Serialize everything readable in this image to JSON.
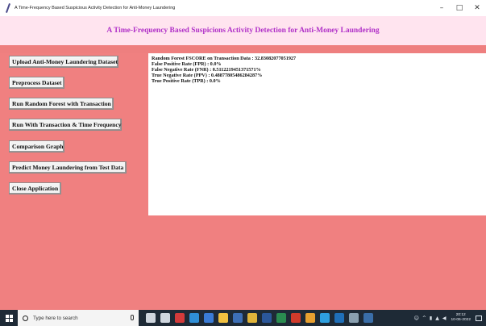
{
  "window": {
    "title": "A Time-Frequency Based Suspicious Activity Detection for Anti-Money Laundering",
    "controls": {
      "minimize": "–",
      "maximize": "□",
      "close": "✕"
    }
  },
  "heading": "A Time-Frequency Based Suspicions Activity Detection for Anti-Money Laundering",
  "buttons": [
    {
      "label": "Upload Anti-Money Laundering Dataset"
    },
    {
      "label": "Preprocess Dataset"
    },
    {
      "label": "Run Random Forest with Transaction"
    },
    {
      "label": "Run With Transaction & Time Frequency"
    },
    {
      "label": "Comparison Graph"
    },
    {
      "label": "Predict Money Laundering from Test Data"
    },
    {
      "label": "Close Application"
    }
  ],
  "output": {
    "lines": [
      "Random Forest FSCORE on Transaction Data : 32.83082077051927",
      "False Positive Rate (FPR) : 0.0%",
      "False Negative Rate (FNR) : 0.5112219451371571%",
      "True Negative Rate (PPV) : 0.48877805486284287%",
      "True Positive Rate (TPR) : 0.0%"
    ]
  },
  "taskbar": {
    "search_placeholder": "Type here to search",
    "clock_time": "20:12",
    "clock_date": "10-06-2022",
    "app_icons": [
      {
        "name": "cortana-icon",
        "color": "#cfd6de"
      },
      {
        "name": "task-view-icon",
        "color": "#cfd6de"
      },
      {
        "name": "opera-icon",
        "color": "#d33b3b"
      },
      {
        "name": "edge-icon",
        "color": "#2f8fd8"
      },
      {
        "name": "store-icon",
        "color": "#3a7bd5"
      },
      {
        "name": "file-explorer-icon",
        "color": "#f0c040"
      },
      {
        "name": "briefcase-icon",
        "color": "#3d6fb6"
      },
      {
        "name": "chrome-icon",
        "color": "#e0b43a"
      },
      {
        "name": "word-icon",
        "color": "#2b579a"
      },
      {
        "name": "terminal-icon",
        "color": "#2a8c50"
      },
      {
        "name": "pdf-icon",
        "color": "#d03b2b"
      },
      {
        "name": "paint-icon",
        "color": "#e8a030"
      },
      {
        "name": "vscode-icon",
        "color": "#2ea0e0"
      },
      {
        "name": "outlook-icon",
        "color": "#1f6fb8"
      },
      {
        "name": "monitor-icon",
        "color": "#8aa0b0"
      },
      {
        "name": "python-icon",
        "color": "#3a6ea8"
      }
    ]
  }
}
